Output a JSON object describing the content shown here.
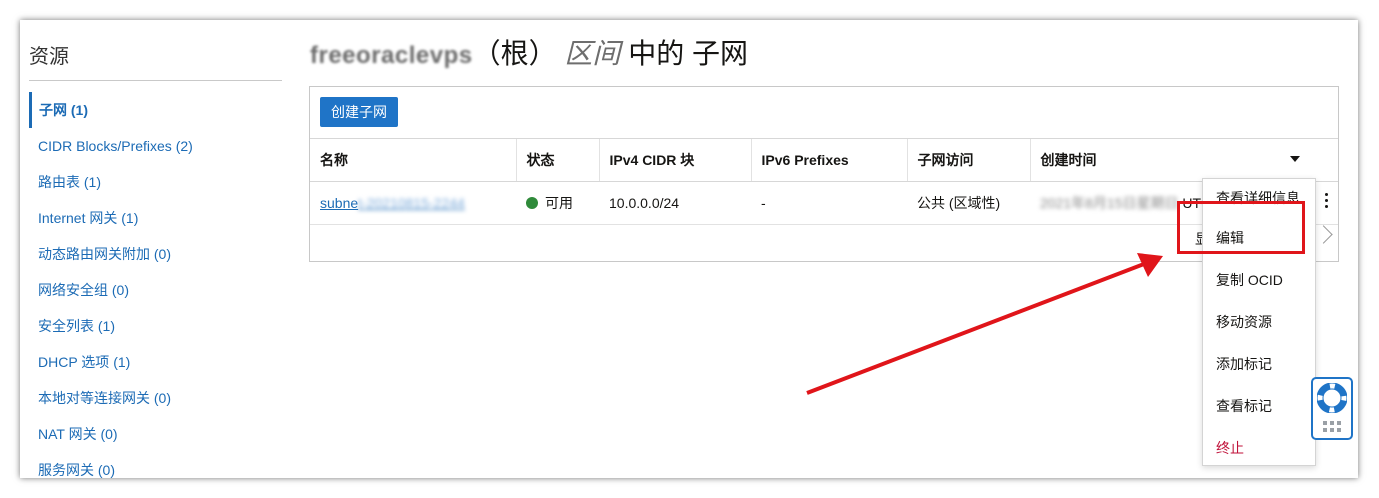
{
  "sidebar": {
    "title": "资源",
    "items": [
      {
        "label": "子网 (1)",
        "active": true
      },
      {
        "label": "CIDR Blocks/Prefixes (2)"
      },
      {
        "label": "路由表 (1)"
      },
      {
        "label": "Internet 网关 (1)"
      },
      {
        "label": "动态路由网关附加 (0)"
      },
      {
        "label": "网络安全组 (0)"
      },
      {
        "label": "安全列表 (1)"
      },
      {
        "label": "DHCP 选项 (1)"
      },
      {
        "label": "本地对等连接网关 (0)"
      },
      {
        "label": "NAT 网关 (0)"
      },
      {
        "label": "服务网关 (0)"
      }
    ]
  },
  "header": {
    "compartment": "freeoraclevps",
    "root": "（根）",
    "scope": "区间",
    "in": "中的",
    "resource": "子网"
  },
  "toolbar": {
    "create_label": "创建子网"
  },
  "table": {
    "columns": [
      "名称",
      "状态",
      "IPv4 CIDR 块",
      "IPv6 Prefixes",
      "子网访问",
      "创建时间"
    ],
    "rows": [
      {
        "name_prefix": "subne",
        "name_blurred": "t-20210815-2244",
        "status": "可用",
        "ipv4": "10.0.0.0/24",
        "ipv6": "-",
        "access": "公共 (区域性)",
        "created_blurred": "2021年8月15日星期日",
        "created_suffix": "UTC"
      }
    ],
    "footer_partial": "显"
  },
  "menu": {
    "items": [
      "查看详细信息",
      "编辑",
      "复制 OCID",
      "移动资源",
      "添加标记",
      "查看标记",
      "终止"
    ]
  },
  "colors": {
    "accent": "#1f74c7",
    "link": "#1c6bb5",
    "status_ok": "#2f8a3a",
    "annotation_red": "#e0151a",
    "danger": "#c0123a"
  },
  "icons": {
    "help": "lifebuoy-icon",
    "grip": "drag-grip-icon",
    "row_actions": "kebab-menu-icon",
    "sort": "caret-down-icon",
    "next": "chevron-right-icon"
  }
}
